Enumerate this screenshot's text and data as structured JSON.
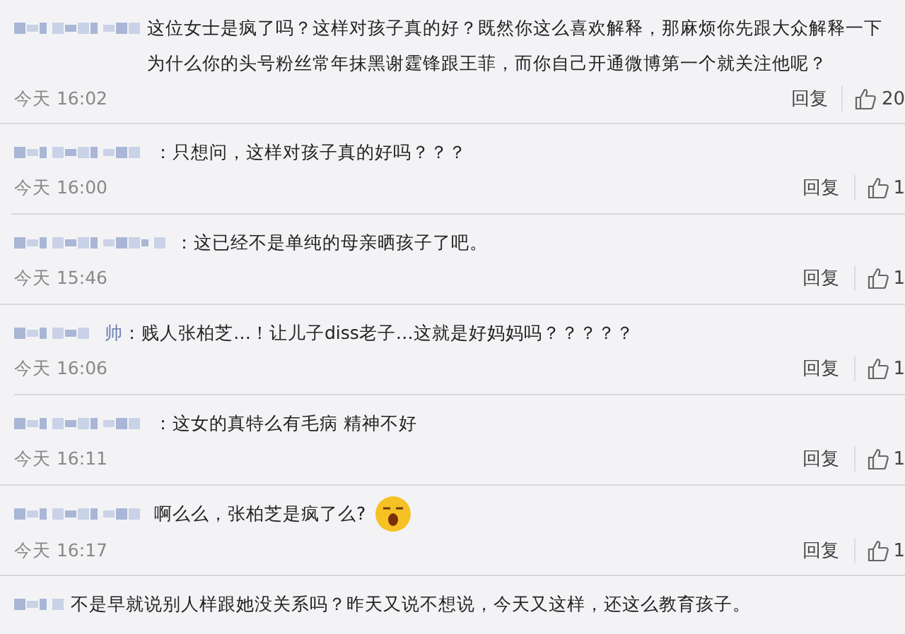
{
  "comments": [
    {
      "text": "这位女士是疯了吗？这样对孩子真的好？既然你这么喜欢解释，那麻烦你先跟大众解释一下为什么你的头号粉丝常年抹黑谢霆锋跟王菲，而你自己开通微博第一个就关注他呢？",
      "time": "今天 16:02",
      "reply": "回复",
      "likes": "20"
    },
    {
      "text": "：只想问，这样对孩子真的好吗？？？",
      "time": "今天 16:00",
      "reply": "回复",
      "likes": "1"
    },
    {
      "text": "：这已经不是单纯的母亲晒孩子了吧。",
      "time": "今天 15:46",
      "reply": "回复",
      "likes": "1"
    },
    {
      "name_visible": "帅",
      "text": "：贱人张柏芝…！让儿子diss老子…这就是好妈妈吗？？？？？",
      "time": "今天 16:06",
      "reply": "回复",
      "likes": "1"
    },
    {
      "text": "：这女的真特么有毛病 精神不好",
      "time": "今天 16:11",
      "reply": "回复",
      "likes": "1"
    },
    {
      "text": "啊么么，张柏芝是疯了么?",
      "emoji": true,
      "time": "今天 16:17",
      "reply": "回复",
      "likes": "1"
    },
    {
      "text": "不是早就说别人样跟她没关系吗？昨天又说不想说，今天又这样，还这么教育孩子。"
    }
  ]
}
